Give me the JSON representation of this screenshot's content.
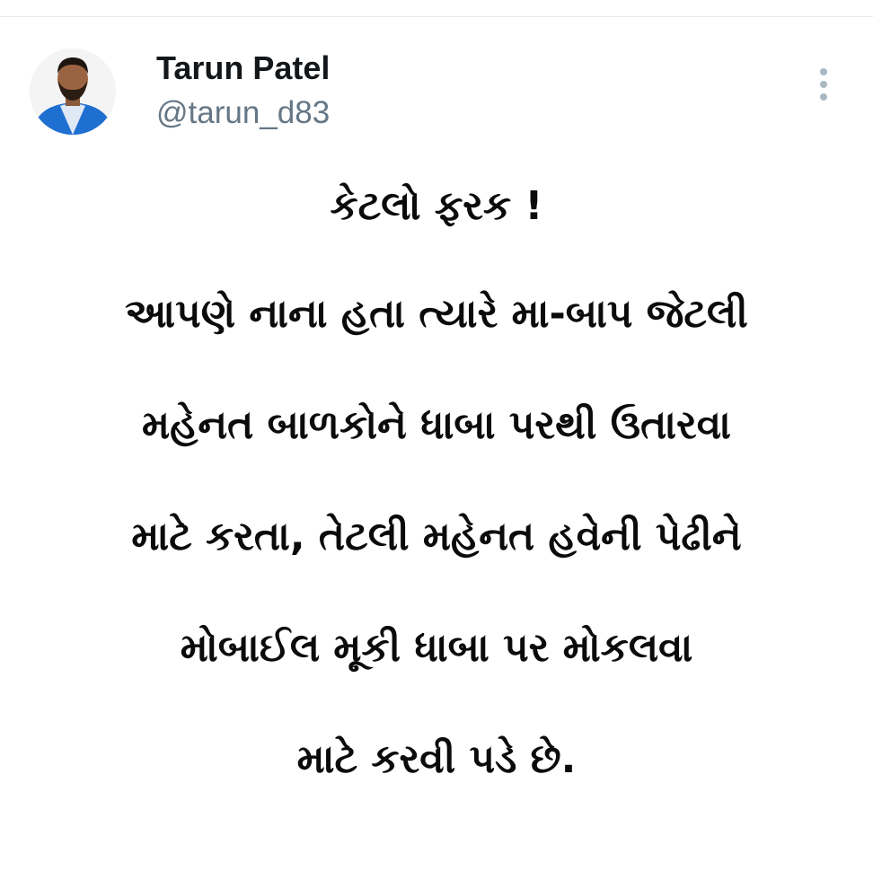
{
  "author": {
    "display_name": "Tarun Patel",
    "handle": "@tarun_d83",
    "avatar_icon": "profile-photo"
  },
  "menu": {
    "icon": "more-vertical-icon"
  },
  "tweet": {
    "title": "કેટલો ફરક !",
    "lines": [
      "આપણે નાના હતા ત્યારે મા-બાપ જેટલી",
      "મહેનત બાળકોને ધાબા પરથી ઉતારવા",
      "માટે કરતા, તેટલી મહેનત હવેની પેઢીને",
      "મોબાઈલ મૂકી ધાબા પર મોકલવા",
      "માટે કરવી પડે છે."
    ]
  },
  "colors": {
    "name": "#14171a",
    "handle": "#657786",
    "body_text": "#0b0b0b",
    "menu_dots": "#aab8c2",
    "avatar_jacket": "#1f6fd1"
  }
}
